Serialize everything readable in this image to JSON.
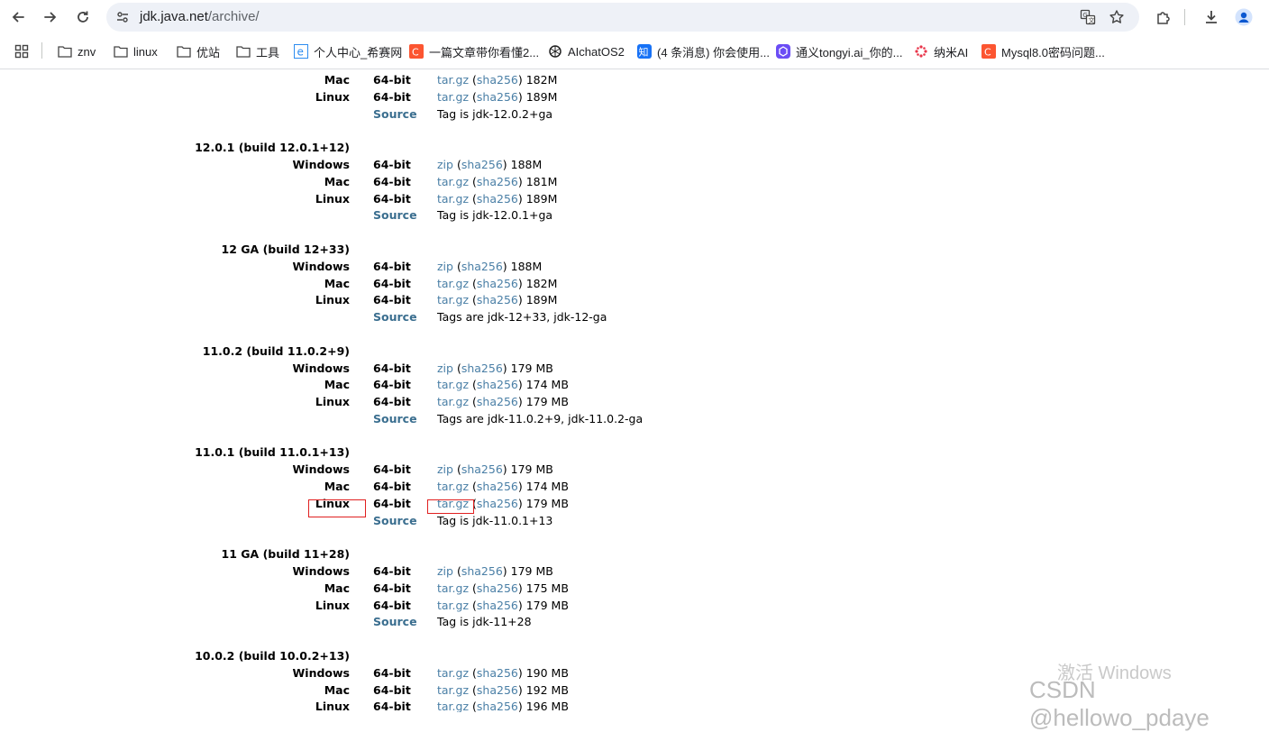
{
  "browser": {
    "url_host": "jdk.java.net",
    "url_path": "/archive/",
    "bookmarks": [
      {
        "label": "znv",
        "icon": "folder-icon"
      },
      {
        "label": "linux",
        "icon": "folder-icon"
      },
      {
        "label": "优站",
        "icon": "folder-icon"
      },
      {
        "label": "工具",
        "icon": "folder-icon"
      },
      {
        "label": "个人中心_希赛网",
        "icon": "site-e-icon"
      },
      {
        "label": "一篇文章带你看懂2...",
        "icon": "csdn-icon"
      },
      {
        "label": "AIchatOS2",
        "icon": "openai-icon"
      },
      {
        "label": "(4 条消息) 你会使用...",
        "icon": "zhihu-icon"
      },
      {
        "label": "通义tongyi.ai_你的...",
        "icon": "tongyi-icon"
      },
      {
        "label": "纳米AI",
        "icon": "nami-icon"
      },
      {
        "label": "Mysql8.0密码问题...",
        "icon": "csdn-icon"
      }
    ]
  },
  "colors": {
    "link": "#4a7fa6",
    "source_label": "#3a6e8f",
    "highlight_box": "#e02020",
    "omnibox_bg": "#eef1f7"
  },
  "archive": {
    "partial_top": {
      "rows": [
        {
          "os": "Mac",
          "bits": "64-bit",
          "file": "tar.gz",
          "sha": "sha256",
          "size": "182M"
        },
        {
          "os": "Linux",
          "bits": "64-bit",
          "file": "tar.gz",
          "sha": "sha256",
          "size": "189M"
        }
      ],
      "source_label": "Source",
      "source_text": "Tag is jdk-12.0.2+ga"
    },
    "releases": [
      {
        "title": "12.0.1 (build 12.0.1+12)",
        "rows": [
          {
            "os": "Windows",
            "bits": "64-bit",
            "file": "zip",
            "sha": "sha256",
            "size": "188M"
          },
          {
            "os": "Mac",
            "bits": "64-bit",
            "file": "tar.gz",
            "sha": "sha256",
            "size": "181M"
          },
          {
            "os": "Linux",
            "bits": "64-bit",
            "file": "tar.gz",
            "sha": "sha256",
            "size": "189M"
          }
        ],
        "source_label": "Source",
        "source_text": "Tag is jdk-12.0.1+ga"
      },
      {
        "title": "12 GA (build 12+33)",
        "rows": [
          {
            "os": "Windows",
            "bits": "64-bit",
            "file": "zip",
            "sha": "sha256",
            "size": "188M"
          },
          {
            "os": "Mac",
            "bits": "64-bit",
            "file": "tar.gz",
            "sha": "sha256",
            "size": "182M"
          },
          {
            "os": "Linux",
            "bits": "64-bit",
            "file": "tar.gz",
            "sha": "sha256",
            "size": "189M"
          }
        ],
        "source_label": "Source",
        "source_text": "Tags are jdk-12+33, jdk-12-ga"
      },
      {
        "title": "11.0.2 (build 11.0.2+9)",
        "rows": [
          {
            "os": "Windows",
            "bits": "64-bit",
            "file": "zip",
            "sha": "sha256",
            "size": "179 MB"
          },
          {
            "os": "Mac",
            "bits": "64-bit",
            "file": "tar.gz",
            "sha": "sha256",
            "size": "174 MB"
          },
          {
            "os": "Linux",
            "bits": "64-bit",
            "file": "tar.gz",
            "sha": "sha256",
            "size": "179 MB"
          }
        ],
        "source_label": "Source",
        "source_text": "Tags are jdk-11.0.2+9, jdk-11.0.2-ga"
      },
      {
        "title": "11.0.1 (build 11.0.1+13)",
        "rows": [
          {
            "os": "Windows",
            "bits": "64-bit",
            "file": "zip",
            "sha": "sha256",
            "size": "179 MB"
          },
          {
            "os": "Mac",
            "bits": "64-bit",
            "file": "tar.gz",
            "sha": "sha256",
            "size": "174 MB"
          },
          {
            "os": "Linux",
            "bits": "64-bit",
            "file": "tar.gz",
            "sha": "sha256",
            "size": "179 MB"
          }
        ],
        "source_label": "Source",
        "source_text": "Tag is jdk-11.0.1+13"
      },
      {
        "title": "11 GA (build 11+28)",
        "rows": [
          {
            "os": "Windows",
            "bits": "64-bit",
            "file": "zip",
            "sha": "sha256",
            "size": "179 MB"
          },
          {
            "os": "Mac",
            "bits": "64-bit",
            "file": "tar.gz",
            "sha": "sha256",
            "size": "175 MB"
          },
          {
            "os": "Linux",
            "bits": "64-bit",
            "file": "tar.gz",
            "sha": "sha256",
            "size": "179 MB"
          }
        ],
        "source_label": "Source",
        "source_text": "Tag is jdk-11+28"
      },
      {
        "title": "10.0.2 (build 10.0.2+13)",
        "rows": [
          {
            "os": "Windows",
            "bits": "64-bit",
            "file": "tar.gz",
            "sha": "sha256",
            "size": "190 MB"
          },
          {
            "os": "Mac",
            "bits": "64-bit",
            "file": "tar.gz",
            "sha": "sha256",
            "size": "192 MB"
          },
          {
            "os": "Linux",
            "bits": "64-bit",
            "file": "tar.gz",
            "sha": "sha256",
            "size": "196 MB"
          }
        ]
      }
    ]
  },
  "overlay": {
    "activate_windows": "激活 Windows",
    "csdn_watermark": "CSDN @hellowo_pdaye"
  }
}
